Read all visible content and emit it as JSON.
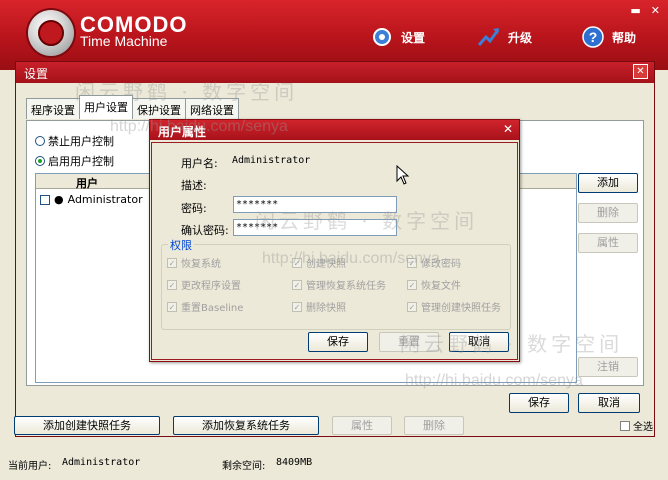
{
  "app": {
    "brand": "COMODO",
    "product": "Time Machine",
    "nav": [
      {
        "label": "设置",
        "icon": "gear-icon"
      },
      {
        "label": "升级",
        "icon": "upgrade-arrow-icon"
      },
      {
        "label": "帮助",
        "icon": "help-icon"
      }
    ]
  },
  "settings_window": {
    "title": "设置",
    "tabs": [
      "程序设置",
      "用户设置",
      "保护设置",
      "网络设置"
    ],
    "radio_disable": "禁止用户控制",
    "radio_enable": "启用用户控制",
    "list_header": "用户",
    "users": [
      "Administrator"
    ],
    "side_buttons": {
      "add": "添加",
      "delete": "删除",
      "properties": "属性",
      "logout": "注销"
    },
    "save": "保存",
    "cancel": "取消"
  },
  "dialog": {
    "title": "用户属性",
    "username_label": "用户名:",
    "username_value": "Administrator",
    "description_label": "描述:",
    "password_label": "密码:",
    "password_value": "*******",
    "confirm_label": "确认密码:",
    "confirm_value": "*******",
    "permissions_title": "权限",
    "permissions": [
      [
        "恢复系统",
        "创建快照",
        "修改密码"
      ],
      [
        "更改程序设置",
        "管理恢复系统任务",
        "恢复文件"
      ],
      [
        "重置Baseline",
        "删除快照",
        "管理创建快照任务"
      ]
    ],
    "save": "保存",
    "reset": "重置",
    "cancel": "取消"
  },
  "bottom_buttons": {
    "add_snapshot_task": "添加创建快照任务",
    "add_restore_task": "添加恢复系统任务",
    "properties": "属性",
    "delete": "删除",
    "select_all": "全选"
  },
  "status": {
    "current_user_label": "当前用户:",
    "current_user": "Administrator",
    "free_space_label": "剩余空间:",
    "free_space": "8409MB"
  },
  "watermark": {
    "chinese": "闲云野鹤 · 数字空间",
    "url": "http://hi.baidu.com/senya"
  },
  "colors": {
    "brand_red": "#c0181f",
    "legend_blue": "#0046d5"
  }
}
